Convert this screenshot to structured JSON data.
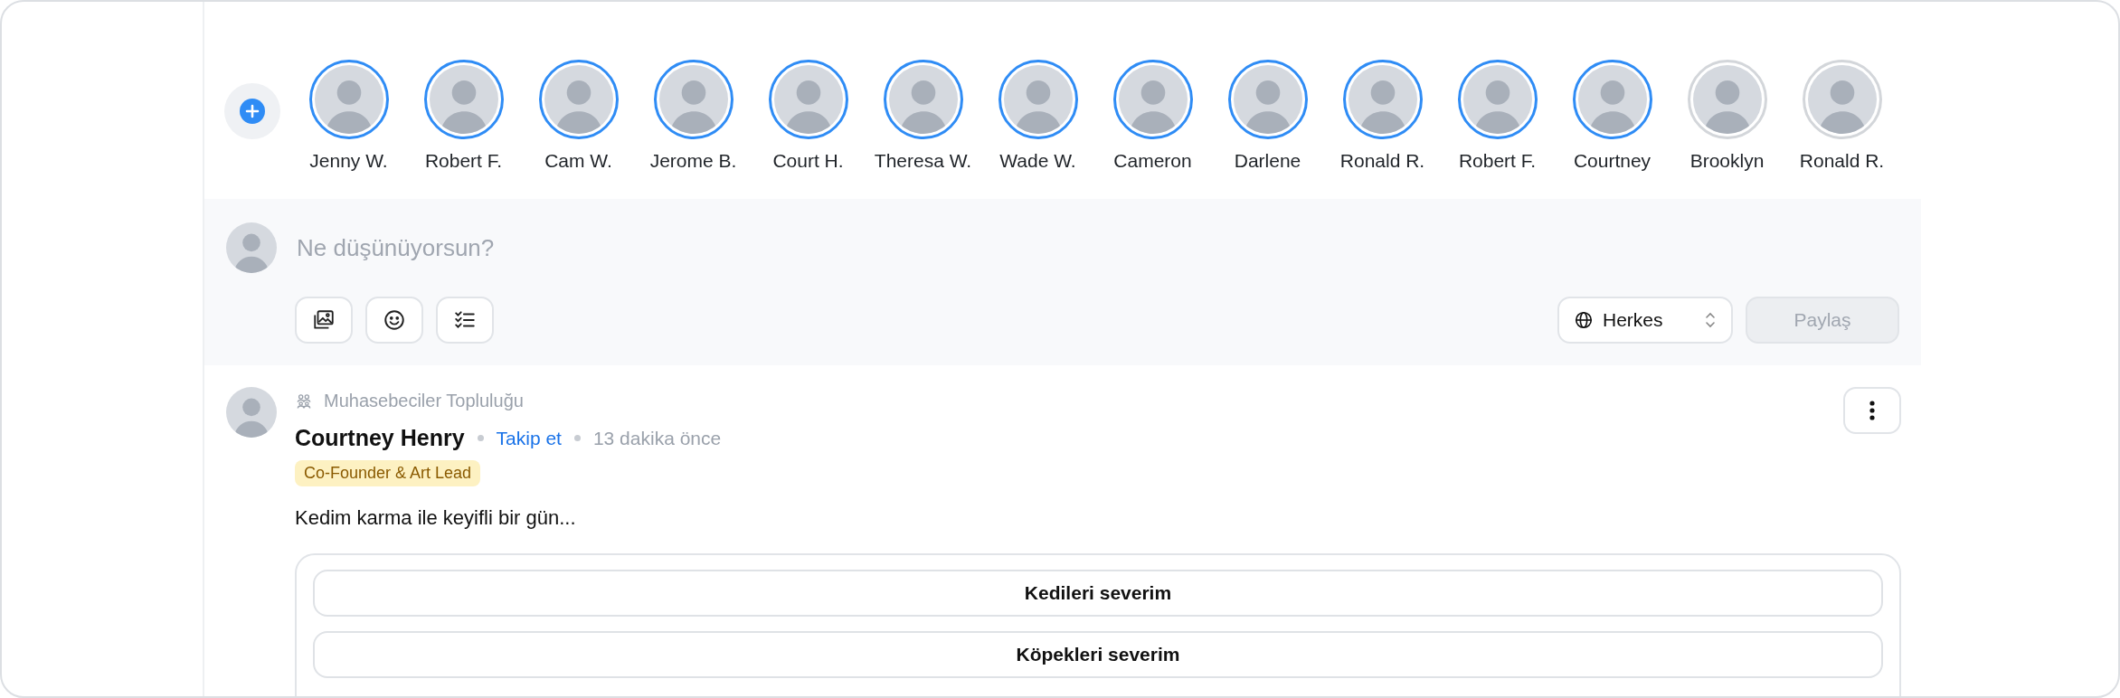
{
  "stories": [
    {
      "name": "Jenny W.",
      "seen": false
    },
    {
      "name": "Robert F.",
      "seen": false
    },
    {
      "name": "Cam W.",
      "seen": false
    },
    {
      "name": "Jerome B.",
      "seen": false
    },
    {
      "name": "Court H.",
      "seen": false
    },
    {
      "name": "Theresa W.",
      "seen": false
    },
    {
      "name": "Wade W.",
      "seen": false
    },
    {
      "name": "Cameron",
      "seen": false
    },
    {
      "name": "Darlene",
      "seen": false
    },
    {
      "name": "Ronald R.",
      "seen": false
    },
    {
      "name": "Robert F.",
      "seen": false
    },
    {
      "name": "Courtney",
      "seen": false
    },
    {
      "name": "Brooklyn",
      "seen": true
    },
    {
      "name": "Ronald R.",
      "seen": true
    }
  ],
  "composer": {
    "placeholder": "Ne düşünüyorsun?",
    "audience": "Herkes",
    "share_button": {
      "label": "Paylaş",
      "disabled": true
    }
  },
  "post": {
    "community": "Muhasebeciler Topluluğu",
    "author": "Courtney Henry",
    "follow": "Takip et",
    "time": "13 dakika önce",
    "badge": "Co-Founder & Art Lead",
    "text": "Kedim karma ile keyifli bir gün...",
    "poll": [
      {
        "label": "Kedileri severim"
      },
      {
        "label": "Köpekleri severim"
      }
    ]
  }
}
